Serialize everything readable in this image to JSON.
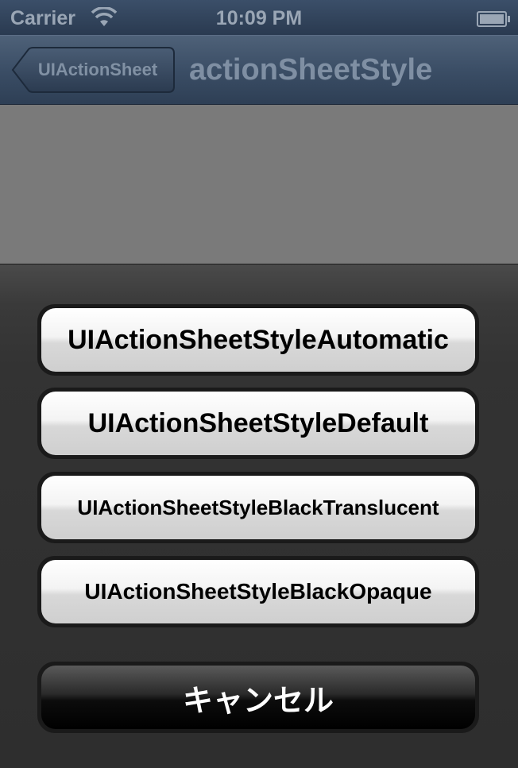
{
  "status_bar": {
    "carrier": "Carrier",
    "time": "10:09 PM",
    "wifi_icon": "wifi-icon",
    "battery_icon": "battery-icon"
  },
  "nav_bar": {
    "back_label": "UIActionSheet",
    "title": "actionSheetStyle"
  },
  "action_sheet": {
    "buttons": [
      {
        "label": "UIActionSheetStyleAutomatic"
      },
      {
        "label": "UIActionSheetStyleDefault"
      },
      {
        "label": "UIActionSheetStyleBlackTranslucent"
      },
      {
        "label": "UIActionSheetStyleBlackOpaque"
      }
    ],
    "cancel_label": "キャンセル"
  },
  "colors": {
    "nav_tint": "#3b4e66",
    "sheet_background": "#333333",
    "cancel_button": "#000000"
  }
}
